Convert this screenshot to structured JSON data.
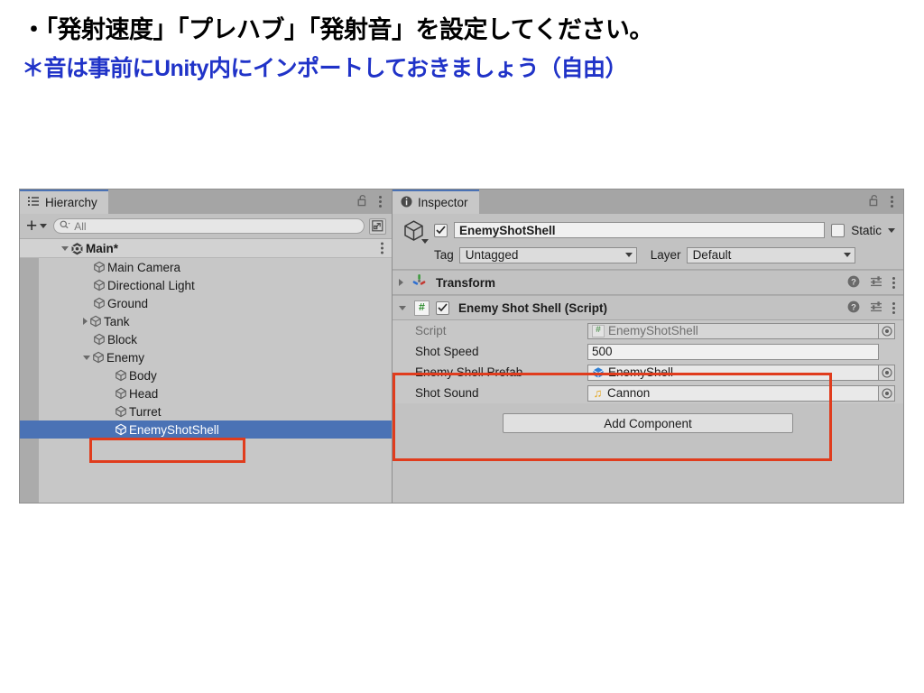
{
  "slide": {
    "line1": "・「発射速度」「プレハブ」「発射音」を設定してください。",
    "line2": "＊音は事前にUnity内にインポートしておきましょう（自由）",
    "line2_color": "#2033c8"
  },
  "hierarchy": {
    "tab_label": "Hierarchy",
    "tab_icon": "hierarchy-list-icon",
    "lock_icon": "lock-open-icon",
    "menu_icon": "kebab-menu-icon",
    "toolbar": {
      "create_label": "+",
      "create_caret": "▾",
      "search_placeholder": "All",
      "search_icon": "search-magnifier-icon",
      "window_icon": "open-in-window-icon"
    },
    "items": [
      {
        "label": "Main*",
        "depth": 0,
        "twisty": "open",
        "icon": "unity-scene-icon",
        "root": true,
        "selected": false
      },
      {
        "label": "Main Camera",
        "depth": 1,
        "twisty": "none",
        "icon": "gameobject-cube-icon",
        "root": false,
        "selected": false
      },
      {
        "label": "Directional Light",
        "depth": 1,
        "twisty": "none",
        "icon": "gameobject-cube-icon",
        "root": false,
        "selected": false
      },
      {
        "label": "Ground",
        "depth": 1,
        "twisty": "none",
        "icon": "gameobject-cube-icon",
        "root": false,
        "selected": false
      },
      {
        "label": "Tank",
        "depth": 1,
        "twisty": "closed",
        "icon": "gameobject-cube-icon",
        "root": false,
        "selected": false
      },
      {
        "label": "Block",
        "depth": 1,
        "twisty": "none",
        "icon": "gameobject-cube-icon",
        "root": false,
        "selected": false
      },
      {
        "label": "Enemy",
        "depth": 1,
        "twisty": "open",
        "icon": "gameobject-cube-icon",
        "root": false,
        "selected": false
      },
      {
        "label": "Body",
        "depth": 2,
        "twisty": "none",
        "icon": "gameobject-cube-icon",
        "root": false,
        "selected": false
      },
      {
        "label": "Head",
        "depth": 2,
        "twisty": "none",
        "icon": "gameobject-cube-icon",
        "root": false,
        "selected": false
      },
      {
        "label": "Turret",
        "depth": 2,
        "twisty": "none",
        "icon": "gameobject-cube-icon",
        "root": false,
        "selected": false
      },
      {
        "label": "EnemyShotShell",
        "depth": 2,
        "twisty": "none",
        "icon": "gameobject-cube-icon",
        "root": false,
        "selected": true
      }
    ],
    "selection_color": "#4a72b5"
  },
  "inspector": {
    "tab_label": "Inspector",
    "tab_icon": "info-circle-icon",
    "lock_icon": "lock-open-icon",
    "menu_icon": "kebab-menu-icon",
    "gameobject": {
      "icon": "gameobject-cube-icon",
      "enabled_checkbox": true,
      "name": "EnemyShotShell",
      "static_label": "Static",
      "static_checked": false,
      "tag_label": "Tag",
      "tag_value": "Untagged",
      "layer_label": "Layer",
      "layer_value": "Default"
    },
    "components": [
      {
        "title": "Transform",
        "icon": "transform-axis-icon",
        "expanded": false,
        "has_enable_checkbox": false,
        "help_icon": "help-circle-icon",
        "preset_icon": "preset-sliders-icon",
        "menu_icon": "kebab-menu-icon"
      },
      {
        "title": "Enemy Shot Shell (Script)",
        "icon": "csharp-script-icon",
        "icon_glyph": "#",
        "expanded": true,
        "has_enable_checkbox": true,
        "enabled": true,
        "help_icon": "help-circle-icon",
        "preset_icon": "preset-sliders-icon",
        "menu_icon": "kebab-menu-icon"
      }
    ],
    "properties": [
      {
        "label": "Script",
        "value": "EnemyShotShell",
        "icon": "csharp-script-icon",
        "icon_glyph": "#",
        "dim": true,
        "picker": true,
        "highlighted": false
      },
      {
        "label": "Shot Speed",
        "value": "500",
        "icon": "",
        "icon_glyph": "",
        "dim": false,
        "picker": false,
        "highlighted": true
      },
      {
        "label": "Enemy Shell Prefab",
        "value": "EnemyShell",
        "icon": "prefab-cube-icon",
        "icon_glyph": "",
        "dim": false,
        "picker": true,
        "highlighted": true
      },
      {
        "label": "Shot Sound",
        "value": "Cannon",
        "icon": "audioclip-note-icon",
        "icon_glyph": "♫",
        "dim": false,
        "picker": true,
        "highlighted": true
      }
    ],
    "add_component_label": "Add Component"
  },
  "annotations": {
    "box_color": "#e03c1d",
    "boxes": [
      {
        "name": "hierarchy-enemyshotshell-highlight"
      },
      {
        "name": "inspector-script-fields-highlight"
      }
    ]
  }
}
